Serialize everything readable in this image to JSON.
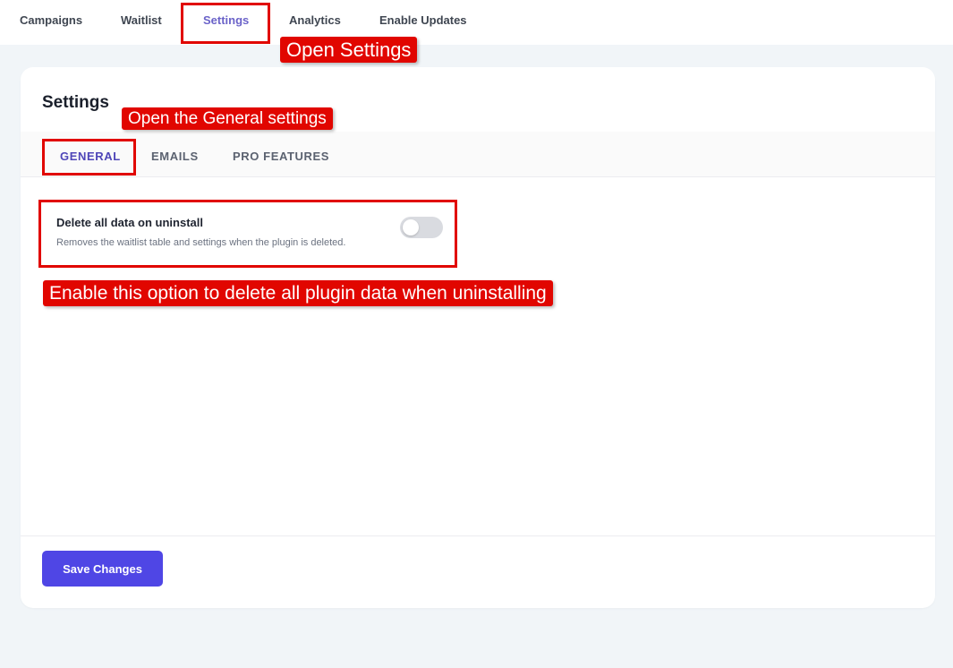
{
  "topnav": {
    "items": [
      {
        "label": "Campaigns",
        "active": false
      },
      {
        "label": "Waitlist",
        "active": false
      },
      {
        "label": "Settings",
        "active": true
      },
      {
        "label": "Analytics",
        "active": false
      },
      {
        "label": "Enable Updates",
        "active": false
      }
    ]
  },
  "settings": {
    "title": "Settings",
    "tabs": [
      {
        "label": "GENERAL",
        "active": true
      },
      {
        "label": "EMAILS",
        "active": false
      },
      {
        "label": "PRO FEATURES",
        "active": false
      }
    ],
    "option": {
      "title": "Delete all data on uninstall",
      "description": "Removes the waitlist table and settings when the plugin is deleted.",
      "enabled": false
    },
    "save_label": "Save Changes"
  },
  "annotations": {
    "open_settings": "Open Settings",
    "open_general": "Open the General settings",
    "enable_option": "Enable this option to delete all plugin data when uninstalling"
  },
  "colors": {
    "accent": "#4f46e5",
    "annotation": "#e10600",
    "background": "#f1f5f8"
  }
}
